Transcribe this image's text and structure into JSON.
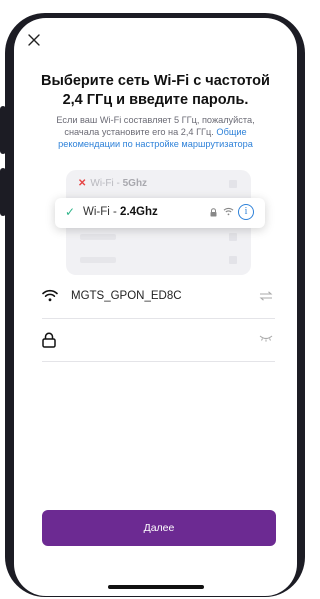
{
  "screen": {
    "title": "Выберите сеть Wi-Fi с частотой 2,4 ГГц и введите пароль.",
    "subtitle_text": "Если ваш Wi-Fi составляет 5 ГГц, пожалуйста, сначала установите его на 2,4 ГГц.",
    "subtitle_link": "Общие рекомендации по настройке маршрутизатора"
  },
  "illustration": {
    "band_5ghz_prefix": "Wi-Fi - ",
    "band_5ghz_value": "5Ghz",
    "band_24ghz_prefix": "Wi-Fi - ",
    "band_24ghz_value": "2.4Ghz",
    "info_symbol": "i"
  },
  "form": {
    "ssid_value": "MGTS_GPON_ED8C",
    "password_value": ""
  },
  "footer": {
    "next_button_label": "Далее"
  },
  "colors": {
    "accent": "#6c2a92",
    "link": "#2f82d9",
    "check": "#2fb58a",
    "error": "#e64545"
  },
  "icons": [
    "close-icon",
    "cross-icon",
    "check-icon",
    "lock-icon",
    "wifi-icon",
    "info-icon",
    "switch-network-icon",
    "eye-closed-icon"
  ]
}
